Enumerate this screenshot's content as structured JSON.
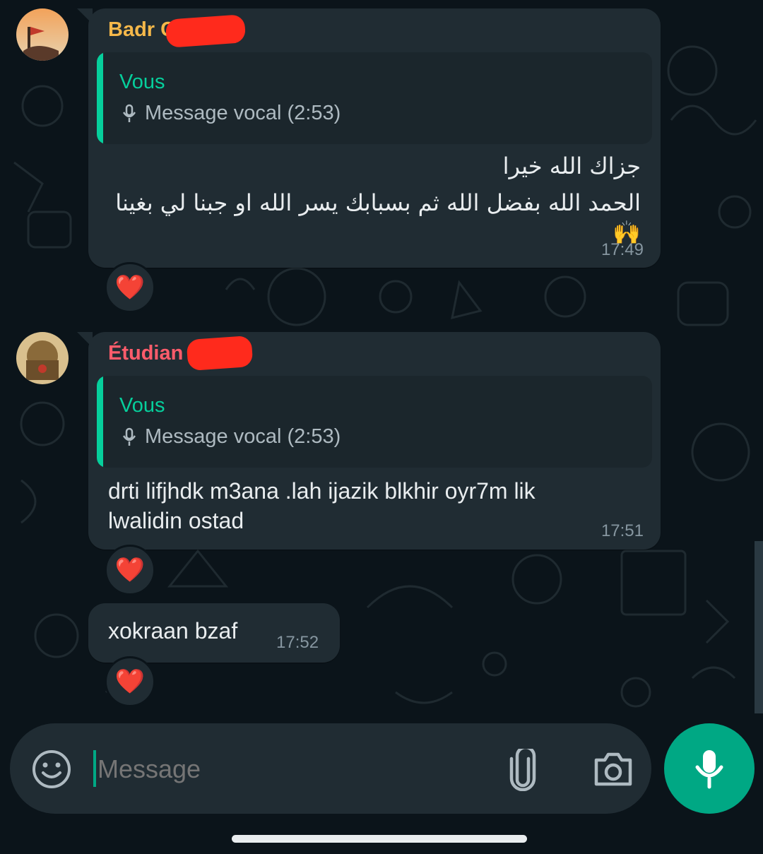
{
  "messages": [
    {
      "sender": "Badr C",
      "sender_color": "#f5b84a",
      "quoted_author": "Vous",
      "quoted_text": "Message vocal (2:53)",
      "text_lines": [
        "جزاك الله خيرا",
        "الحمد الله بفضل الله ثم بسبابك يسر الله او جبنا لي بغينا 🙌"
      ],
      "time": "17:49",
      "reaction": "❤️"
    },
    {
      "sender": "Étudian",
      "sender_color": "#ff5c6b",
      "quoted_author": "Vous",
      "quoted_text": "Message vocal (2:53)",
      "text_lines": [
        "drti lifjhdk m3ana .lah ijazik blkhir oyr7m lik",
        "lwalidin ostad"
      ],
      "time": "17:51",
      "reaction": "❤️"
    },
    {
      "text": "xokraan bzaf",
      "time": "17:52",
      "reaction": "❤️"
    }
  ],
  "composer": {
    "placeholder": "Message",
    "emoji_icon": "emoji-icon",
    "attach_icon": "paperclip-icon",
    "camera_icon": "camera-icon",
    "mic_icon": "microphone-icon"
  },
  "colors": {
    "background": "#0b141a",
    "bubble": "#202c33",
    "accent": "#00a884",
    "quote_accent": "#06cf9c"
  }
}
